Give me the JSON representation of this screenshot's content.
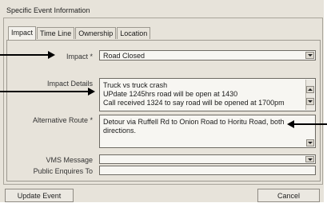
{
  "panel": {
    "title": "Specific Event Information"
  },
  "tabs": [
    {
      "label": "Impact"
    },
    {
      "label": "Time Line"
    },
    {
      "label": "Ownership"
    },
    {
      "label": "Location"
    }
  ],
  "form": {
    "impact": {
      "label": "Impact *",
      "value": "Road Closed"
    },
    "impact_details": {
      "label": "Impact Details",
      "lines": [
        "Truck vs truck crash",
        "UPdate 1245hrs road will be open at 1430",
        "Call received 1324 to say road will be opened at 1700pm"
      ]
    },
    "alternative_route": {
      "label": "Alternative Route *",
      "lines": [
        "Detour via Ruffell Rd to Onion Road to Horitu Road, both",
        "directions."
      ]
    },
    "vms_message": {
      "label": "VMS Message",
      "value": ""
    },
    "public_enquiries": {
      "label": "Public Enquires To",
      "value": ""
    }
  },
  "buttons": {
    "update": "Update Event",
    "cancel": "Cancel"
  }
}
